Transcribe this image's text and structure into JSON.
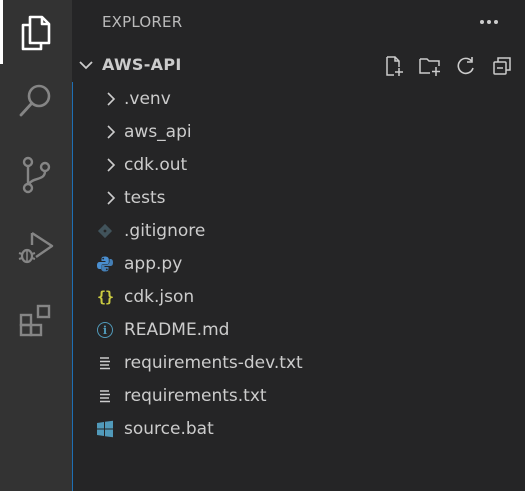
{
  "sidebar": {
    "title": "EXPLORER",
    "more_label": "···"
  },
  "section": {
    "title": "AWS-API"
  },
  "tree": {
    "folders": [
      {
        "label": ".venv"
      },
      {
        "label": "aws_api"
      },
      {
        "label": "cdk.out"
      },
      {
        "label": "tests"
      }
    ],
    "files": [
      {
        "label": ".gitignore",
        "icon": "git-icon"
      },
      {
        "label": "app.py",
        "icon": "python-icon"
      },
      {
        "label": "cdk.json",
        "icon": "json-braces-icon",
        "icon_text": "{}"
      },
      {
        "label": "README.md",
        "icon": "info-icon",
        "icon_text": "i"
      },
      {
        "label": "requirements-dev.txt",
        "icon": "text-lines-icon"
      },
      {
        "label": "requirements.txt",
        "icon": "text-lines-icon"
      },
      {
        "label": "source.bat",
        "icon": "windows-icon"
      }
    ]
  },
  "colors": {
    "activity_bar": "#333333",
    "sidebar": "#252526",
    "text": "#cccccc",
    "focus_border": "#1f6fb3",
    "python_blue": "#4a8fd0",
    "json_yellow": "#cbcb41",
    "info_blue": "#519aba",
    "windows_blue": "#519aba"
  }
}
